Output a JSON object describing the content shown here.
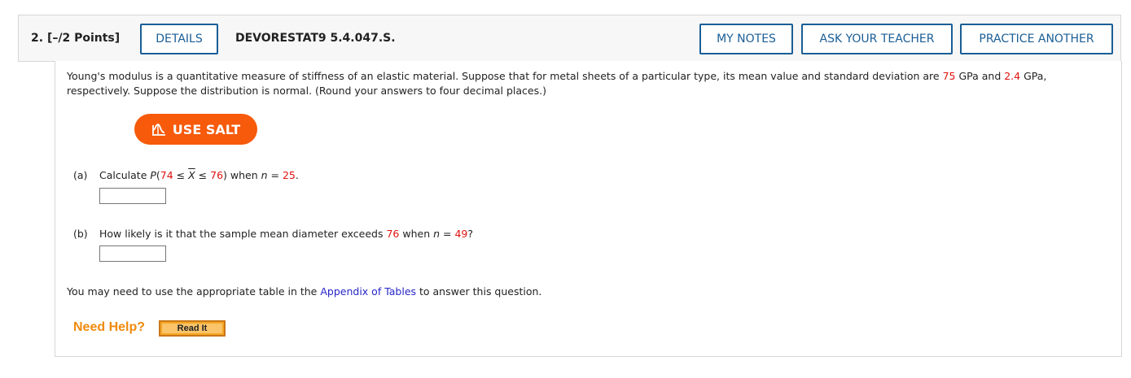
{
  "header": {
    "question_number": "2.",
    "points": "[–/2 Points]",
    "details_label": "DETAILS",
    "problem_code": "DEVORESTAT9 5.4.047.S.",
    "my_notes_label": "MY NOTES",
    "ask_teacher_label": "ASK YOUR TEACHER",
    "practice_label": "PRACTICE ANOTHER"
  },
  "prompt": {
    "intro": "Young's modulus is a quantitative measure of stiffness of an elastic material. Suppose that for metal sheets of a particular type, its mean value and standard deviation are ",
    "mean": "75",
    "mid1": " GPa and ",
    "sd": "2.4",
    "mid2": " GPa, respectively. Suppose the distribution is normal. (Round your answers to four decimal places.)"
  },
  "salt_button": {
    "label": "USE SALT",
    "icon": "salt-chart-icon"
  },
  "part_a": {
    "label": "(a)",
    "text1": "Calculate ",
    "p": "P",
    "open": "(",
    "low": "74",
    "le1": " ≤ ",
    "x": "X",
    "le2": " ≤ ",
    "high": "76",
    "close": ") when ",
    "n": "n",
    "eq": " = ",
    "nval": "25",
    "end": ".",
    "answer": ""
  },
  "part_b": {
    "label": "(b)",
    "text1": "How likely is it that the sample mean diameter exceeds ",
    "threshold": "76",
    "text2": " when ",
    "n": "n",
    "eq": " = ",
    "nval": "49",
    "end": "?",
    "answer": ""
  },
  "footnote": {
    "before": "You may need to use the appropriate table in the ",
    "link": "Appendix of Tables",
    "after": " to answer this question."
  },
  "help": {
    "label": "Need Help?",
    "read_it": "Read It"
  },
  "colors": {
    "accent_blue": "#1a5e96",
    "salt_orange": "#f65a0a",
    "highlight_red": "#e0120f",
    "link_blue": "#2626c8"
  }
}
